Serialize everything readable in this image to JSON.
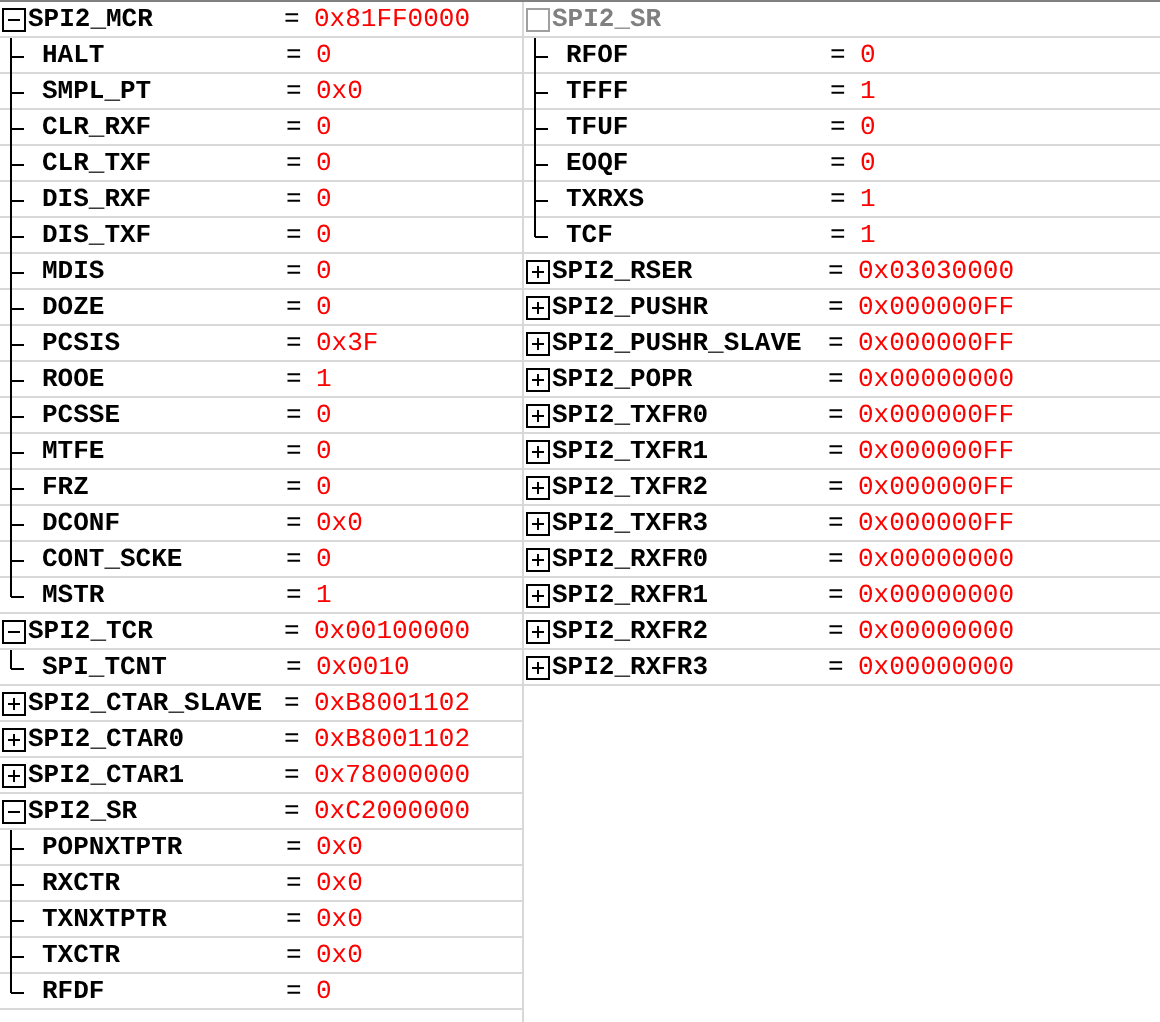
{
  "columns": [
    {
      "registers": [
        {
          "kind": "register",
          "name": "SPI2_MCR",
          "sign": "=",
          "value": "0x81FF0000",
          "expanded": true,
          "fields": [
            {
              "name": "HALT",
              "sign": "=",
              "value": "0"
            },
            {
              "name": "SMPL_PT",
              "sign": "=",
              "value": "0x0"
            },
            {
              "name": "CLR_RXF",
              "sign": "=",
              "value": "0"
            },
            {
              "name": "CLR_TXF",
              "sign": "=",
              "value": "0"
            },
            {
              "name": "DIS_RXF",
              "sign": "=",
              "value": "0"
            },
            {
              "name": "DIS_TXF",
              "sign": "=",
              "value": "0"
            },
            {
              "name": "MDIS",
              "sign": "=",
              "value": "0"
            },
            {
              "name": "DOZE",
              "sign": "=",
              "value": "0"
            },
            {
              "name": "PCSIS",
              "sign": "=",
              "value": "0x3F"
            },
            {
              "name": "ROOE",
              "sign": "=",
              "value": "1"
            },
            {
              "name": "PCSSE",
              "sign": "=",
              "value": "0"
            },
            {
              "name": "MTFE",
              "sign": "=",
              "value": "0"
            },
            {
              "name": "FRZ",
              "sign": "=",
              "value": "0"
            },
            {
              "name": "DCONF",
              "sign": "=",
              "value": "0x0"
            },
            {
              "name": "CONT_SCKE",
              "sign": "=",
              "value": "0"
            },
            {
              "name": "MSTR",
              "sign": "=",
              "value": "1"
            }
          ]
        },
        {
          "kind": "register",
          "name": "SPI2_TCR",
          "sign": "=",
          "value": "0x00100000",
          "expanded": true,
          "fields": [
            {
              "name": "SPI_TCNT",
              "sign": "=",
              "value": "0x0010"
            }
          ]
        },
        {
          "kind": "register",
          "name": "SPI2_CTAR_SLAVE",
          "sign": "=",
          "value": "0xB8001102",
          "expanded": false
        },
        {
          "kind": "register",
          "name": "SPI2_CTAR0",
          "sign": "=",
          "value": "0xB8001102",
          "expanded": false
        },
        {
          "kind": "register",
          "name": "SPI2_CTAR1",
          "sign": "=",
          "value": "0x78000000",
          "expanded": false
        },
        {
          "kind": "register",
          "name": "SPI2_SR",
          "sign": "=",
          "value": "0xC2000000",
          "expanded": true,
          "fields": [
            {
              "name": "POPNXTPTR",
              "sign": "=",
              "value": "0x0"
            },
            {
              "name": "RXCTR",
              "sign": "=",
              "value": "0x0"
            },
            {
              "name": "TXNXTPTR",
              "sign": "=",
              "value": "0x0"
            },
            {
              "name": "TXCTR",
              "sign": "=",
              "value": "0x0"
            },
            {
              "name": "RFDF",
              "sign": "=",
              "value": "0"
            }
          ]
        }
      ]
    },
    {
      "registers": [
        {
          "kind": "continued",
          "name": "SPI2_SR",
          "fields": [
            {
              "name": "RFOF",
              "sign": "=",
              "value": "0"
            },
            {
              "name": "TFFF",
              "sign": "=",
              "value": "1"
            },
            {
              "name": "TFUF",
              "sign": "=",
              "value": "0"
            },
            {
              "name": "EOQF",
              "sign": "=",
              "value": "0"
            },
            {
              "name": "TXRXS",
              "sign": "=",
              "value": "1"
            },
            {
              "name": "TCF",
              "sign": "=",
              "value": "1"
            }
          ]
        },
        {
          "kind": "register",
          "name": "SPI2_RSER",
          "sign": "=",
          "value": "0x03030000",
          "expanded": false
        },
        {
          "kind": "register",
          "name": "SPI2_PUSHR",
          "sign": "=",
          "value": "0x000000FF",
          "expanded": false
        },
        {
          "kind": "register",
          "name": "SPI2_PUSHR_SLAVE",
          "sign": "=",
          "value": "0x000000FF",
          "expanded": false
        },
        {
          "kind": "register",
          "name": "SPI2_POPR",
          "sign": "=",
          "value": "0x00000000",
          "expanded": false
        },
        {
          "kind": "register",
          "name": "SPI2_TXFR0",
          "sign": "=",
          "value": "0x000000FF",
          "expanded": false
        },
        {
          "kind": "register",
          "name": "SPI2_TXFR1",
          "sign": "=",
          "value": "0x000000FF",
          "expanded": false
        },
        {
          "kind": "register",
          "name": "SPI2_TXFR2",
          "sign": "=",
          "value": "0x000000FF",
          "expanded": false
        },
        {
          "kind": "register",
          "name": "SPI2_TXFR3",
          "sign": "=",
          "value": "0x000000FF",
          "expanded": false
        },
        {
          "kind": "register",
          "name": "SPI2_RXFR0",
          "sign": "=",
          "value": "0x00000000",
          "expanded": false
        },
        {
          "kind": "register",
          "name": "SPI2_RXFR1",
          "sign": "=",
          "value": "0x00000000",
          "expanded": false
        },
        {
          "kind": "register",
          "name": "SPI2_RXFR2",
          "sign": "=",
          "value": "0x00000000",
          "expanded": false
        },
        {
          "kind": "register",
          "name": "SPI2_RXFR3",
          "sign": "=",
          "value": "0x00000000",
          "expanded": false
        }
      ]
    }
  ]
}
